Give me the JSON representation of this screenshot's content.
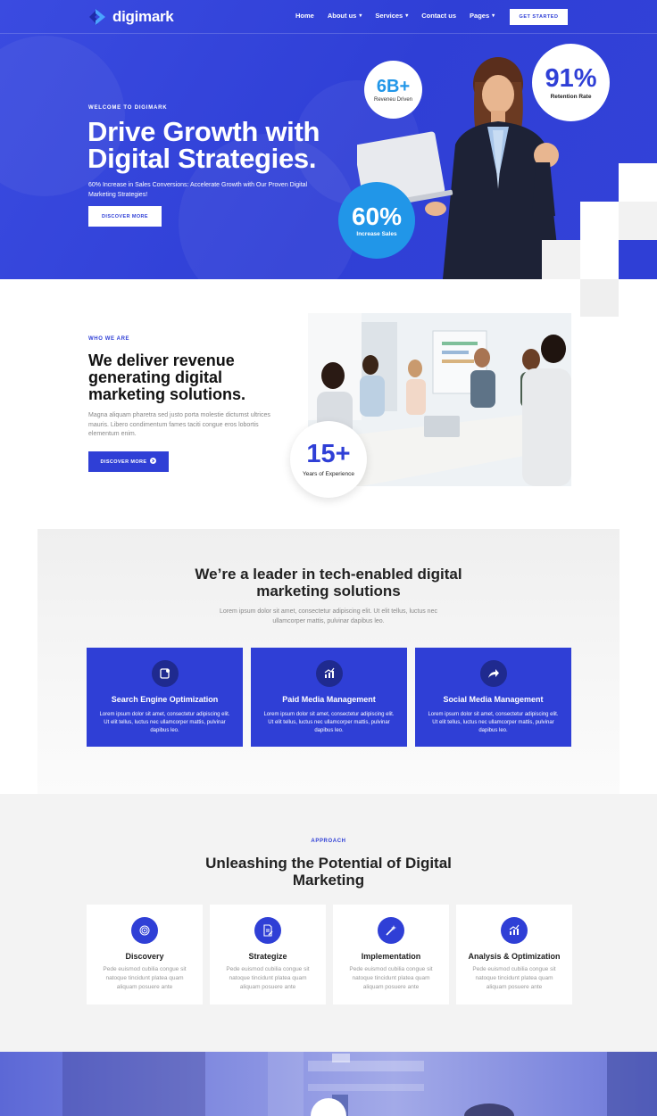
{
  "brand": {
    "name": "digimark",
    "accent": "#2f3fd6",
    "accent_light": "#2196e8"
  },
  "nav": {
    "items": [
      {
        "label": "Home",
        "has_dropdown": false
      },
      {
        "label": "About us",
        "has_dropdown": true
      },
      {
        "label": "Services",
        "has_dropdown": true
      },
      {
        "label": "Contact us",
        "has_dropdown": false
      },
      {
        "label": "Pages",
        "has_dropdown": true
      }
    ],
    "cta_label": "GET STARTED"
  },
  "hero": {
    "eyebrow": "WELCOME TO DIGIMARK",
    "title": "Drive Growth with Digital Strategies.",
    "subtitle": "60% Increase in Sales Conversions: Accelerate Growth with Our Proven Digital Marketing Strategies!",
    "button_label": "DISCOVER MORE",
    "stats": [
      {
        "value": "6B+",
        "label": "Reveneu Driven"
      },
      {
        "value": "91%",
        "label": "Retention Rate"
      },
      {
        "value": "60%",
        "label": "Increase Sales"
      }
    ]
  },
  "who": {
    "eyebrow": "WHO WE ARE",
    "title": "We deliver revenue generating digital marketing solutions.",
    "description": "Magna aliquam pharetra sed justo porta molestie dictumst ultrices mauris. Libero condimentum fames taciti congue eros lobortis elementum enim.",
    "button_label": "DISCOVER MORE",
    "experience": {
      "value": "15+",
      "label": "Years of Experience"
    }
  },
  "leader": {
    "title": "We’re a leader in tech-enabled digital marketing solutions",
    "description": "Lorem ipsum dolor sit amet, consectetur adipiscing elit. Ut elit tellus, luctus nec ullamcorper mattis, pulvinar dapibus leo.",
    "services": [
      {
        "title": "Search Engine Optimization",
        "icon": "document-search-icon",
        "description": "Lorem ipsum dolor sit amet, consectetur adipiscing elit. Ut elit tellus, luctus nec ullamcorper mattis, pulvinar dapibus leo."
      },
      {
        "title": "Paid Media Management",
        "icon": "chart-growth-icon",
        "description": "Lorem ipsum dolor sit amet, consectetur adipiscing elit. Ut elit tellus, luctus nec ullamcorper mattis, pulvinar dapibus leo."
      },
      {
        "title": "Social Media Management",
        "icon": "share-arrow-icon",
        "description": "Lorem ipsum dolor sit amet, consectetur adipiscing elit. Ut elit tellus, luctus nec ullamcorper mattis, pulvinar dapibus leo."
      }
    ]
  },
  "approach": {
    "eyebrow": "APPROACH",
    "title": "Unleashing the Potential of Digital Marketing",
    "steps": [
      {
        "title": "Discovery",
        "icon": "fingerprint-icon",
        "description": "Pede euismod cubilia congue sit natoque tincidunt platea quam aliquam posuere ante"
      },
      {
        "title": "Strategize",
        "icon": "document-edit-icon",
        "description": "Pede euismod cubilia congue sit natoque tincidunt platea quam aliquam posuere ante"
      },
      {
        "title": "Implementation",
        "icon": "magic-wand-icon",
        "description": "Pede euismod cubilia congue sit natoque tincidunt platea quam aliquam posuere ante"
      },
      {
        "title": "Analysis & Optimization",
        "icon": "analytics-icon",
        "description": "Pede euismod cubilia congue sit natoque tincidunt platea quam aliquam posuere ante"
      }
    ]
  }
}
